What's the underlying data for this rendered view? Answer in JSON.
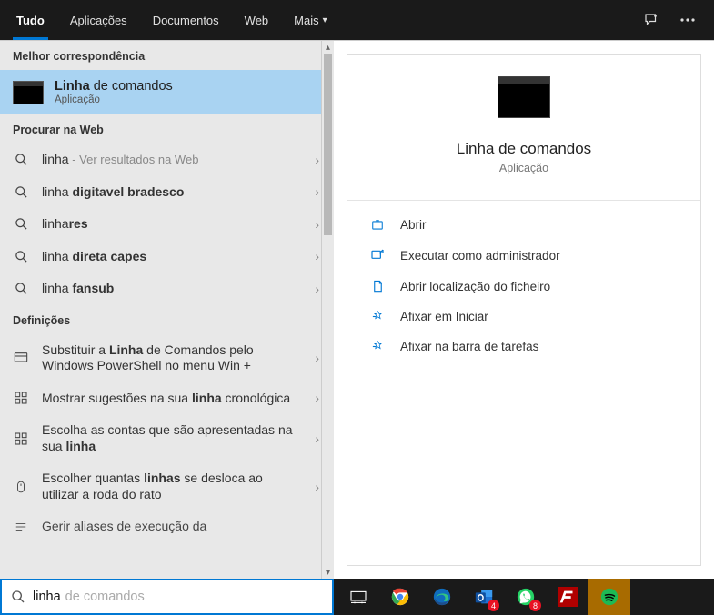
{
  "header": {
    "tabs": [
      {
        "label": "Tudo",
        "active": true
      },
      {
        "label": "Aplicações"
      },
      {
        "label": "Documentos"
      },
      {
        "label": "Web"
      },
      {
        "label": "Mais",
        "dropdown": true
      }
    ]
  },
  "left": {
    "best_match_header": "Melhor correspondência",
    "best_match": {
      "title_bold": "Linha",
      "title_rest": " de comandos",
      "subtitle": "Aplicação"
    },
    "web_header": "Procurar na Web",
    "web_results": [
      {
        "prefix": "linha",
        "bold": "",
        "dim": " - Ver resultados na Web"
      },
      {
        "prefix": "linha ",
        "bold": "digitavel bradesco",
        "dim": ""
      },
      {
        "prefix": "linha",
        "bold": "res",
        "dim": ""
      },
      {
        "prefix": "linha ",
        "bold": "direta capes",
        "dim": ""
      },
      {
        "prefix": "linha ",
        "bold": "fansub",
        "dim": ""
      }
    ],
    "settings_header": "Definições",
    "settings_results": [
      "Substituir a <b>Linha</b> de Comandos pelo Windows PowerShell no menu Win +",
      "Mostrar sugestões na sua <b>linha</b> cronológica",
      "Escolha as contas que são apresentadas na sua <b>linha</b>",
      "Escolher quantas <b>linhas</b> se desloca ao utilizar a roda do rato",
      "Gerir aliases de execução da"
    ]
  },
  "right": {
    "title": "Linha de comandos",
    "subtitle": "Aplicação",
    "actions": [
      {
        "icon": "open",
        "label": "Abrir"
      },
      {
        "icon": "admin",
        "label": "Executar como administrador"
      },
      {
        "icon": "folder",
        "label": "Abrir localização do ficheiro"
      },
      {
        "icon": "pin",
        "label": "Afixar em Iniciar"
      },
      {
        "icon": "pin",
        "label": "Afixar na barra de tarefas"
      }
    ]
  },
  "search": {
    "typed": "linha ",
    "ghost": "de comandos"
  },
  "taskbar": {
    "outlook_badge": "4",
    "whatsapp_badge": "8"
  }
}
